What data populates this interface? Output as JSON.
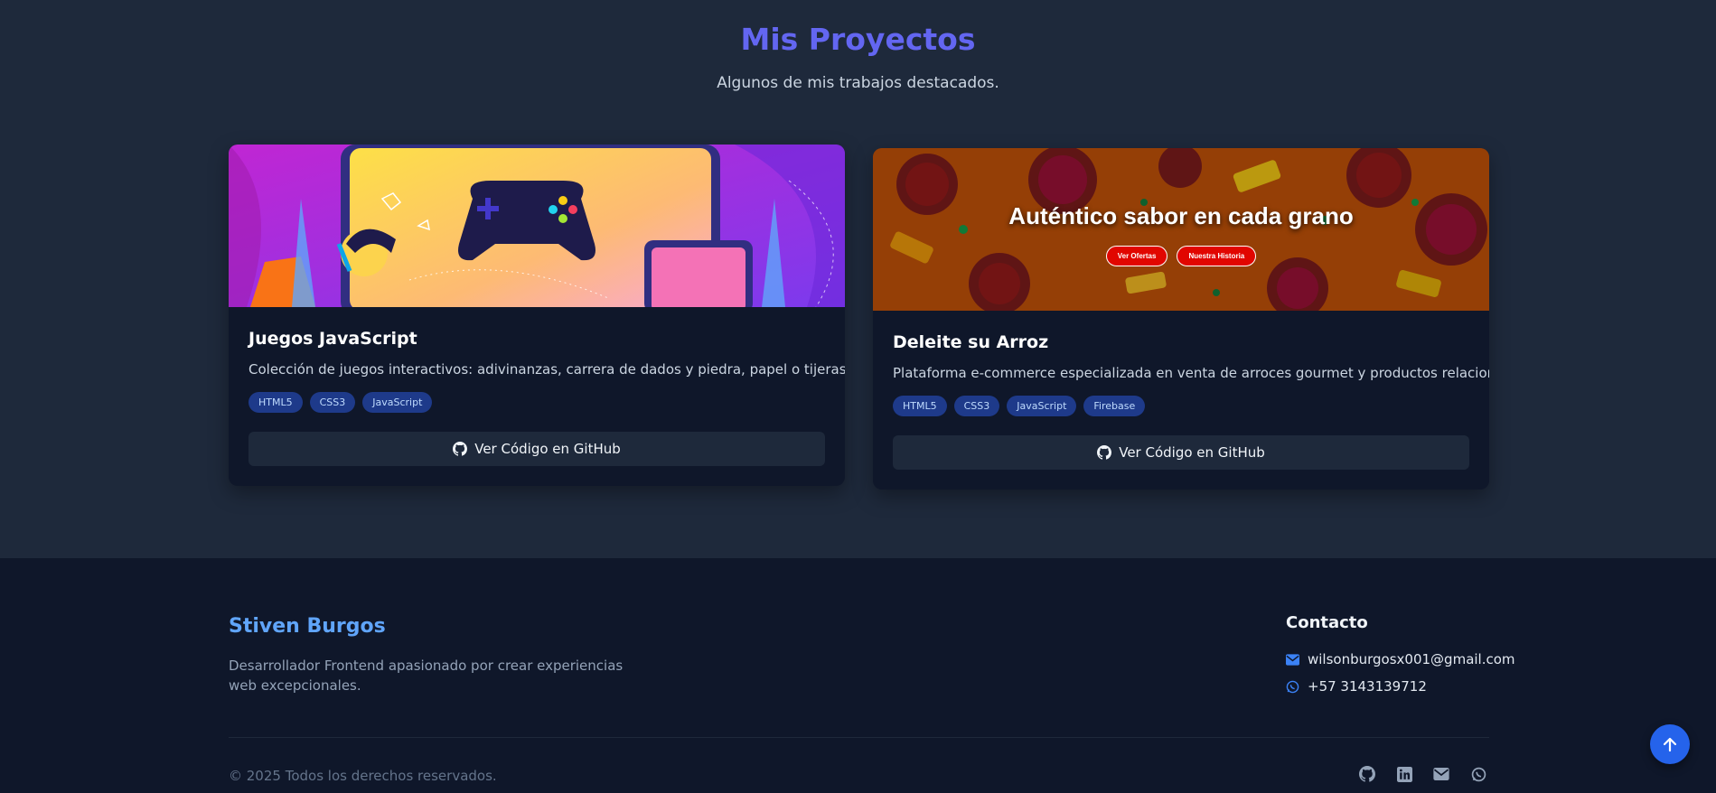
{
  "projects": {
    "title": "Mis Proyectos",
    "subtitle": "Algunos de mis trabajos destacados.",
    "cards": [
      {
        "title": "Juegos JavaScript",
        "description": "Colección de juegos interactivos: adivinanzas, carrera de dados y piedra, papel o tijeras.",
        "tags": [
          "HTML5",
          "CSS3",
          "JavaScript"
        ],
        "button_label": "Ver Código en GitHub",
        "image_icon": "gamepad-illustration"
      },
      {
        "title": "Deleite su Arroz",
        "description": "Plataforma e-commerce especializada en venta de arroces gourmet y productos relacionados.",
        "tags": [
          "HTML5",
          "CSS3",
          "JavaScript",
          "Firebase"
        ],
        "button_label": "Ver Código en GitHub",
        "banner": {
          "title": "Auténtico sabor en cada grano",
          "buttons": [
            "Ver Ofertas",
            "Nuestra Historia"
          ]
        }
      }
    ]
  },
  "footer": {
    "brand": "Stiven Burgos",
    "description": "Desarrollador Frontend apasionado por crear experiencias web excepcionales.",
    "contact_title": "Contacto",
    "email": "wilsonburgosx001@gmail.com",
    "phone": "+57 3143139712",
    "copyright": "© 2025 Todos los derechos reservados.",
    "social_icons": [
      "github-icon",
      "linkedin-icon",
      "mail-icon",
      "whatsapp-icon"
    ]
  },
  "colors": {
    "accent": "#6366f1",
    "brand": "#60a5fa",
    "tag_bg": "#1e3a8a",
    "banner_button": "#e10600",
    "scroll_button": "#2563eb"
  }
}
